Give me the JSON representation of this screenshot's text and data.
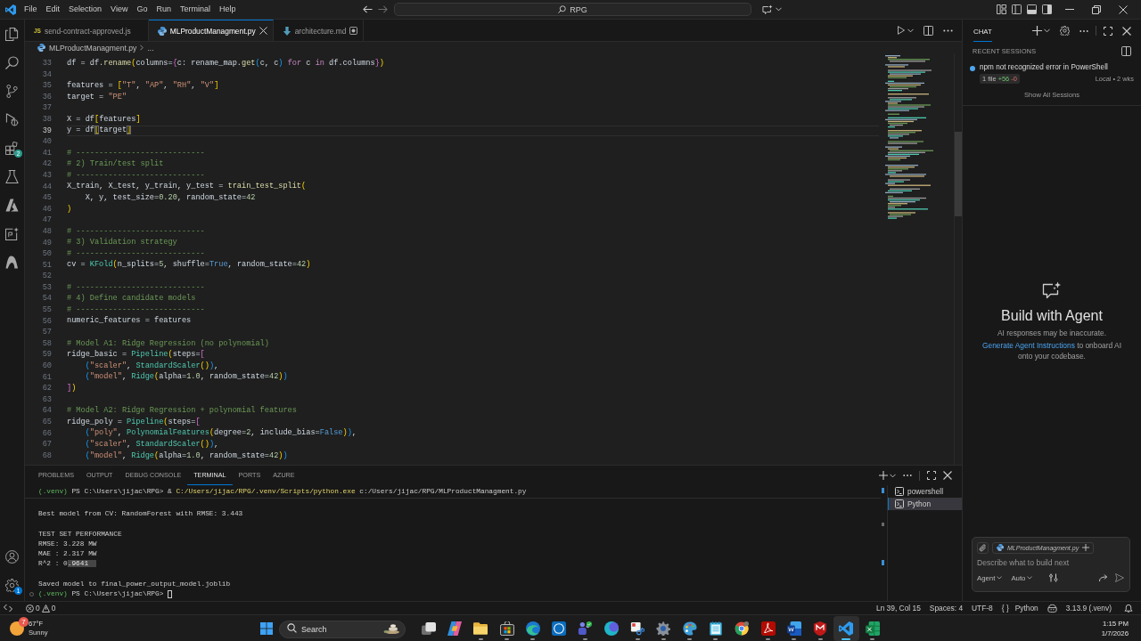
{
  "title_bar": {
    "menu": [
      "File",
      "Edit",
      "Selection",
      "View",
      "Go",
      "Run",
      "Terminal",
      "Help"
    ],
    "command_center": "RPG"
  },
  "activity_bar": {
    "extensions_badge": "2",
    "settings_badge": "1"
  },
  "editor": {
    "tabs": [
      {
        "label": "send-contract-approved.js",
        "kind": "js",
        "type_label": "JS",
        "selected": false,
        "modified": false
      },
      {
        "label": "MLProductManagment.py",
        "kind": "python",
        "selected": true,
        "modified": false
      },
      {
        "label": "architecture.md",
        "kind": "markdown",
        "selected": false,
        "modified": true
      }
    ],
    "breadcrumb": [
      "MLProductManagment.py",
      "..."
    ],
    "lines": [
      {
        "number": "33",
        "current": false,
        "tokens": [
          {
            "text": "df = df.",
            "kind": "plain"
          },
          {
            "text": "rename",
            "kind": "func"
          },
          {
            "text": "(",
            "kind": "bracket1"
          },
          {
            "text": "columns=",
            "kind": "plain"
          },
          {
            "text": "{",
            "kind": "bracket2"
          },
          {
            "text": "c: rename_map.",
            "kind": "plain"
          },
          {
            "text": "get",
            "kind": "func"
          },
          {
            "text": "(",
            "kind": "bracket3"
          },
          {
            "text": "c, c",
            "kind": "plain"
          },
          {
            "text": ")",
            "kind": "bracket3"
          },
          {
            "text": " for",
            "kind": "keyword"
          },
          {
            "text": " c ",
            "kind": "plain"
          },
          {
            "text": "in",
            "kind": "keyword"
          },
          {
            "text": " df.columns",
            "kind": "plain"
          },
          {
            "text": "}",
            "kind": "bracket2"
          },
          {
            "text": ")",
            "kind": "bracket1"
          }
        ]
      },
      {
        "number": "34",
        "current": false
      },
      {
        "number": "35",
        "current": false,
        "tokens": [
          {
            "text": "features = ",
            "kind": "plain"
          },
          {
            "text": "[",
            "kind": "bracket1"
          },
          {
            "text": "\"T\"",
            "kind": "string"
          },
          {
            "text": ", ",
            "kind": "plain"
          },
          {
            "text": "\"AP\"",
            "kind": "string"
          },
          {
            "text": ", ",
            "kind": "plain"
          },
          {
            "text": "\"RH\"",
            "kind": "string"
          },
          {
            "text": ", ",
            "kind": "plain"
          },
          {
            "text": "\"V\"",
            "kind": "string"
          },
          {
            "text": "]",
            "kind": "bracket1"
          }
        ]
      },
      {
        "number": "36",
        "current": false,
        "tokens": [
          {
            "text": "target = ",
            "kind": "plain"
          },
          {
            "text": "\"PE\"",
            "kind": "string"
          }
        ]
      },
      {
        "number": "37",
        "current": false
      },
      {
        "number": "38",
        "current": false,
        "tokens": [
          {
            "text": "X = df",
            "kind": "plain"
          },
          {
            "text": "[",
            "kind": "bracket1"
          },
          {
            "text": "features",
            "kind": "plain"
          },
          {
            "text": "]",
            "kind": "bracket1"
          }
        ]
      },
      {
        "number": "39",
        "current": true,
        "tokens": [
          {
            "text": "y = df",
            "kind": "plain"
          },
          {
            "text": "[",
            "kind": "bracket_match"
          },
          {
            "text": "target",
            "kind": "plain"
          },
          {
            "text": "]",
            "kind": "bracket_match"
          }
        ]
      },
      {
        "number": "40",
        "current": false
      },
      {
        "number": "41",
        "current": false,
        "tokens": [
          {
            "text": "# ----------------------------",
            "kind": "comment"
          }
        ]
      },
      {
        "number": "42",
        "current": false,
        "tokens": [
          {
            "text": "# 2) Train/test split",
            "kind": "comment"
          }
        ]
      },
      {
        "number": "43",
        "current": false,
        "tokens": [
          {
            "text": "# ----------------------------",
            "kind": "comment"
          }
        ]
      },
      {
        "number": "44",
        "current": false,
        "tokens": [
          {
            "text": "X_train, X_test, y_train, y_test = ",
            "kind": "plain"
          },
          {
            "text": "train_test_split",
            "kind": "func"
          },
          {
            "text": "(",
            "kind": "bracket1"
          }
        ]
      },
      {
        "number": "45",
        "current": false,
        "tokens": [
          {
            "text": "    X, y, test_size=",
            "kind": "plain"
          },
          {
            "text": "0.20",
            "kind": "number"
          },
          {
            "text": ", random_state=",
            "kind": "plain"
          },
          {
            "text": "42",
            "kind": "number"
          }
        ]
      },
      {
        "number": "46",
        "current": false,
        "tokens": [
          {
            "text": ")",
            "kind": "bracket1"
          }
        ]
      },
      {
        "number": "47",
        "current": false
      },
      {
        "number": "48",
        "current": false,
        "tokens": [
          {
            "text": "# ----------------------------",
            "kind": "comment"
          }
        ]
      },
      {
        "number": "49",
        "current": false,
        "tokens": [
          {
            "text": "# 3) Validation strategy",
            "kind": "comment"
          }
        ]
      },
      {
        "number": "50",
        "current": false,
        "tokens": [
          {
            "text": "# ----------------------------",
            "kind": "comment"
          }
        ]
      },
      {
        "number": "51",
        "current": false,
        "tokens": [
          {
            "text": "cv = ",
            "kind": "plain"
          },
          {
            "text": "KFold",
            "kind": "class"
          },
          {
            "text": "(",
            "kind": "bracket1"
          },
          {
            "text": "n_splits=",
            "kind": "plain"
          },
          {
            "text": "5",
            "kind": "number"
          },
          {
            "text": ", shuffle=",
            "kind": "plain"
          },
          {
            "text": "True",
            "kind": "const"
          },
          {
            "text": ", random_state=",
            "kind": "plain"
          },
          {
            "text": "42",
            "kind": "number"
          },
          {
            "text": ")",
            "kind": "bracket1"
          }
        ]
      },
      {
        "number": "52",
        "current": false
      },
      {
        "number": "53",
        "current": false,
        "tokens": [
          {
            "text": "# ----------------------------",
            "kind": "comment"
          }
        ]
      },
      {
        "number": "54",
        "current": false,
        "tokens": [
          {
            "text": "# 4) Define candidate models",
            "kind": "comment"
          }
        ]
      },
      {
        "number": "55",
        "current": false,
        "tokens": [
          {
            "text": "# ----------------------------",
            "kind": "comment"
          }
        ]
      },
      {
        "number": "56",
        "current": false,
        "tokens": [
          {
            "text": "numeric_features = features",
            "kind": "plain"
          }
        ]
      },
      {
        "number": "57",
        "current": false
      },
      {
        "number": "58",
        "current": false,
        "tokens": [
          {
            "text": "# Model A1: Ridge Regression (no polynomial)",
            "kind": "comment"
          }
        ]
      },
      {
        "number": "59",
        "current": false,
        "tokens": [
          {
            "text": "ridge_basic = ",
            "kind": "plain"
          },
          {
            "text": "Pipeline",
            "kind": "class"
          },
          {
            "text": "(",
            "kind": "bracket1"
          },
          {
            "text": "steps=",
            "kind": "plain"
          },
          {
            "text": "[",
            "kind": "bracket2"
          }
        ]
      },
      {
        "number": "60",
        "current": false,
        "tokens": [
          {
            "text": "    (",
            "kind": "bracket3"
          },
          {
            "text": "\"scaler\"",
            "kind": "string"
          },
          {
            "text": ", ",
            "kind": "plain"
          },
          {
            "text": "StandardScaler",
            "kind": "class"
          },
          {
            "text": "()",
            "kind": "bracket1"
          },
          {
            "text": ")",
            "kind": "bracket3"
          },
          {
            "text": ",",
            "kind": "plain"
          }
        ]
      },
      {
        "number": "61",
        "current": false,
        "tokens": [
          {
            "text": "    (",
            "kind": "bracket3"
          },
          {
            "text": "\"model\"",
            "kind": "string"
          },
          {
            "text": ", ",
            "kind": "plain"
          },
          {
            "text": "Ridge",
            "kind": "class"
          },
          {
            "text": "(",
            "kind": "bracket1"
          },
          {
            "text": "alpha=",
            "kind": "plain"
          },
          {
            "text": "1.0",
            "kind": "number"
          },
          {
            "text": ", random_state=",
            "kind": "plain"
          },
          {
            "text": "42",
            "kind": "number"
          },
          {
            "text": ")",
            "kind": "bracket1"
          },
          {
            "text": ")",
            "kind": "bracket3"
          }
        ]
      },
      {
        "number": "62",
        "current": false,
        "tokens": [
          {
            "text": "]",
            "kind": "bracket2"
          },
          {
            "text": ")",
            "kind": "bracket1"
          }
        ]
      },
      {
        "number": "63",
        "current": false
      },
      {
        "number": "64",
        "current": false,
        "tokens": [
          {
            "text": "# Model A2: Ridge Regression + polynomial features",
            "kind": "comment"
          }
        ]
      },
      {
        "number": "65",
        "current": false,
        "tokens": [
          {
            "text": "ridge_poly = ",
            "kind": "plain"
          },
          {
            "text": "Pipeline",
            "kind": "class"
          },
          {
            "text": "(",
            "kind": "bracket1"
          },
          {
            "text": "steps=",
            "kind": "plain"
          },
          {
            "text": "[",
            "kind": "bracket2"
          }
        ]
      },
      {
        "number": "66",
        "current": false,
        "tokens": [
          {
            "text": "    (",
            "kind": "bracket3"
          },
          {
            "text": "\"poly\"",
            "kind": "string"
          },
          {
            "text": ", ",
            "kind": "plain"
          },
          {
            "text": "PolynomialFeatures",
            "kind": "class"
          },
          {
            "text": "(",
            "kind": "bracket1"
          },
          {
            "text": "degree=",
            "kind": "plain"
          },
          {
            "text": "2",
            "kind": "number"
          },
          {
            "text": ", include_bias=",
            "kind": "plain"
          },
          {
            "text": "False",
            "kind": "const"
          },
          {
            "text": ")",
            "kind": "bracket1"
          },
          {
            "text": ")",
            "kind": "bracket3"
          },
          {
            "text": ",",
            "kind": "plain"
          }
        ]
      },
      {
        "number": "67",
        "current": false,
        "tokens": [
          {
            "text": "    (",
            "kind": "bracket3"
          },
          {
            "text": "\"scaler\"",
            "kind": "string"
          },
          {
            "text": ", ",
            "kind": "plain"
          },
          {
            "text": "StandardScaler",
            "kind": "class"
          },
          {
            "text": "()",
            "kind": "bracket1"
          },
          {
            "text": ")",
            "kind": "bracket3"
          },
          {
            "text": ",",
            "kind": "plain"
          }
        ]
      },
      {
        "number": "68",
        "current": false,
        "tokens": [
          {
            "text": "    (",
            "kind": "bracket3"
          },
          {
            "text": "\"model\"",
            "kind": "string"
          },
          {
            "text": ", ",
            "kind": "plain"
          },
          {
            "text": "Ridge",
            "kind": "class"
          },
          {
            "text": "(",
            "kind": "bracket1"
          },
          {
            "text": "alpha=",
            "kind": "plain"
          },
          {
            "text": "1.0",
            "kind": "number"
          },
          {
            "text": ", random_state=",
            "kind": "plain"
          },
          {
            "text": "42",
            "kind": "number"
          },
          {
            "text": ")",
            "kind": "bracket1"
          },
          {
            "text": ")",
            "kind": "bracket3"
          }
        ]
      }
    ]
  },
  "panel": {
    "tabs": [
      {
        "label": "PROBLEMS",
        "selected": false
      },
      {
        "label": "OUTPUT",
        "selected": false
      },
      {
        "label": "DEBUG CONSOLE",
        "selected": false
      },
      {
        "label": "TERMINAL",
        "selected": true
      },
      {
        "label": "PORTS",
        "selected": false
      },
      {
        "label": "AZURE",
        "selected": false
      }
    ],
    "terminal": {
      "sticky_line": [
        {
          "text": "(.venv)",
          "kind": "env"
        },
        {
          "text": " PS C:\\Users\\jijac\\RPG> & ",
          "kind": "plain"
        },
        {
          "text": "C:/Users/jijac/RPG/.venv/Scripts/python.exe",
          "kind": "command"
        },
        {
          "text": " c:/Users/jijac/RPG/MLProductManagment.py",
          "kind": "plain"
        }
      ],
      "blocks": [
        [
          {
            "kind": "output",
            "tokens": [
              {
                "text": "Best model from CV: RandomForest with RMSE: 3.443",
                "kind": "plain"
              }
            ]
          }
        ],
        [
          {
            "kind": "output",
            "tokens": [
              {
                "text": "TEST SET PERFORMANCE",
                "kind": "plain"
              }
            ]
          },
          {
            "kind": "output",
            "tokens": [
              {
                "text": "RMSE: 3.228 MW",
                "kind": "plain"
              }
            ]
          },
          {
            "kind": "output",
            "tokens": [
              {
                "text": "MAE : 2.317 MW",
                "kind": "plain"
              }
            ]
          },
          {
            "kind": "output",
            "tokens": [
              {
                "text": "R^2 : 0",
                "kind": "plain"
              },
              {
                "text": ".9641",
                "kind": "selected"
              }
            ]
          }
        ],
        [
          {
            "kind": "output",
            "tokens": [
              {
                "text": "Saved model to final_power_output_model.joblib",
                "kind": "plain"
              }
            ]
          },
          {
            "kind": "prompt",
            "tokens": [
              {
                "text": "(.venv)",
                "kind": "env"
              },
              {
                "text": " PS C:\\Users\\jijac\\RPG> ",
                "kind": "plain"
              }
            ]
          }
        ]
      ]
    },
    "terminal_list": [
      {
        "label": "powershell",
        "selected": false
      },
      {
        "label": "Python",
        "selected": true
      }
    ]
  },
  "chat": {
    "title": "CHAT",
    "recent_title": "RECENT SESSIONS",
    "sessions": [
      {
        "title": "npm not recognized error in PowerShell",
        "files": "1 file",
        "added": "+56",
        "removed": "-0",
        "meta": "Local • 2 wks"
      }
    ],
    "show_all": "Show All Sessions",
    "welcome": {
      "title": "Build with Agent",
      "note": "AI responses may be inaccurate.",
      "link": "Generate Agent Instructions",
      "text": " to onboard AI onto your codebase."
    },
    "composer": {
      "attachment": "MLProductManagment.py",
      "placeholder": "Describe what to build next",
      "mode": "Agent",
      "model": "Auto"
    }
  },
  "status_bar": {
    "errors": "0",
    "warnings": "0",
    "position": "Ln 39, Col 15",
    "indentation": "Spaces: 4",
    "encoding": "UTF-8",
    "language_icon": "{ }",
    "language": "Python",
    "interpreter": "3.13.9 (.venv)"
  },
  "taskbar": {
    "weather": {
      "badge": "7",
      "temperature": "67°F",
      "condition": "Sunny"
    },
    "search": {
      "placeholder": "Search"
    },
    "apps": [
      {
        "kind": "taskview",
        "running": false,
        "active": false
      },
      {
        "kind": "assistant",
        "running": false,
        "active": false
      },
      {
        "kind": "folder",
        "running": true,
        "active": false
      },
      {
        "kind": "store",
        "running": true,
        "active": false
      },
      {
        "kind": "browser",
        "running": true,
        "active": false
      },
      {
        "kind": "oem",
        "running": false,
        "active": false
      },
      {
        "kind": "meeting",
        "running": true,
        "active": false
      },
      {
        "kind": "design",
        "running": false,
        "active": false
      },
      {
        "kind": "snipping",
        "running": true,
        "active": false
      },
      {
        "kind": "settings",
        "running": true,
        "active": false
      },
      {
        "kind": "paint",
        "running": true,
        "active": false
      },
      {
        "kind": "notepad",
        "running": true,
        "active": false
      },
      {
        "kind": "chrome",
        "running": false,
        "active": false
      },
      {
        "kind": "pdf",
        "running": true,
        "active": false
      },
      {
        "kind": "word",
        "running": true,
        "active": false
      },
      {
        "kind": "shield",
        "running": true,
        "active": false
      },
      {
        "kind": "code",
        "running": true,
        "active": true
      },
      {
        "kind": "spreadsheet",
        "running": true,
        "active": false
      }
    ],
    "clock": {
      "time": "1:15 PM",
      "date": "1/7/2026"
    }
  }
}
